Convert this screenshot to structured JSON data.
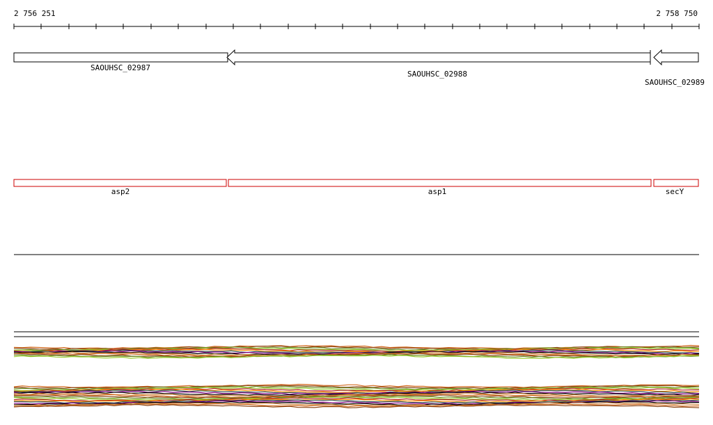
{
  "ruler": {
    "start_label": "2 756 251",
    "end_label": "2 758 750",
    "start": 2756251,
    "end": 2758750
  },
  "genes_track": {
    "color": "#000000",
    "genes": [
      {
        "name": "SAOUHSC_02987",
        "strand": "+"
      },
      {
        "name": "SAOUHSC_02988",
        "strand": "-"
      },
      {
        "name": "SAOUHSC_02989",
        "strand": "-"
      }
    ]
  },
  "features_track": {
    "color": "#cc0000",
    "features": [
      {
        "name": "asp2"
      },
      {
        "name": "asp1"
      },
      {
        "name": "secY"
      }
    ]
  },
  "coverage_tracks": {
    "colors": [
      "#d2691e",
      "#8b4513",
      "#6b8e23",
      "#9acd32",
      "#b22222",
      "#ff8c00",
      "#2f4f4f",
      "#800080",
      "#000000",
      "#cd853f"
    ]
  }
}
